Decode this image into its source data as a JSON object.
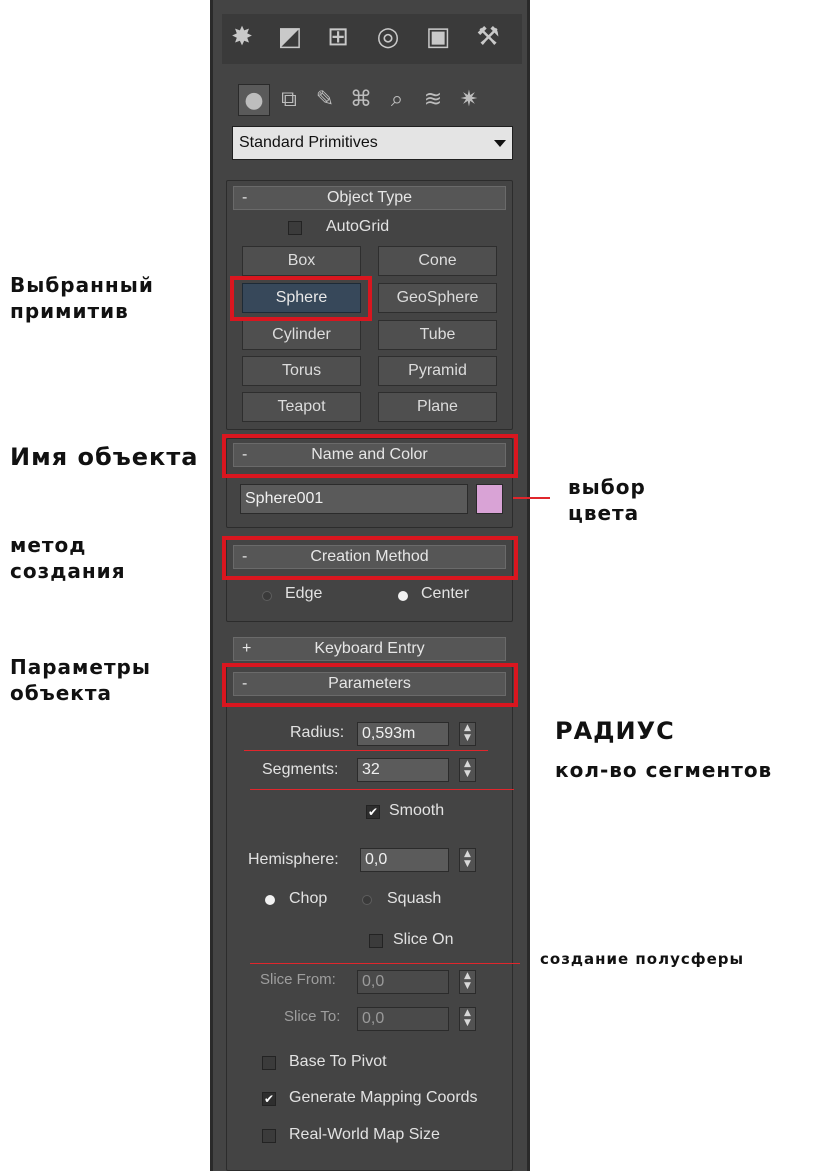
{
  "toolbar": {
    "tabs": [
      {
        "icon": "create-icon",
        "glyph": "✸"
      },
      {
        "icon": "modify-icon",
        "glyph": "◩"
      },
      {
        "icon": "hierarchy-icon",
        "glyph": "⊞"
      },
      {
        "icon": "motion-icon",
        "glyph": "◎"
      },
      {
        "icon": "display-icon",
        "glyph": "▣"
      },
      {
        "icon": "utilities-icon",
        "glyph": "⚒"
      }
    ],
    "subtabs": [
      {
        "icon": "geometry-icon",
        "glyph": "●"
      },
      {
        "icon": "shapes-icon",
        "glyph": "⧉"
      },
      {
        "icon": "lights-icon",
        "glyph": "✎"
      },
      {
        "icon": "cameras-icon",
        "glyph": "⌘"
      },
      {
        "icon": "helpers-icon",
        "glyph": "⌕"
      },
      {
        "icon": "spacewarps-icon",
        "glyph": "≋"
      },
      {
        "icon": "systems-icon",
        "glyph": "✷"
      }
    ]
  },
  "category": {
    "selected": "Standard Primitives"
  },
  "object_type": {
    "header": "Object Type",
    "collapse": "-",
    "autogrid": "AutoGrid",
    "buttons": [
      "Box",
      "Cone",
      "Sphere",
      "GeoSphere",
      "Cylinder",
      "Tube",
      "Torus",
      "Pyramid",
      "Teapot",
      "Plane"
    ],
    "selected": "Sphere"
  },
  "name_color": {
    "header": "Name and Color",
    "collapse": "-",
    "name": "Sphere001",
    "color": "#d9a3d6"
  },
  "creation_method": {
    "header": "Creation Method",
    "collapse": "-",
    "option_edge": "Edge",
    "option_center": "Center",
    "selected": "Center"
  },
  "keyboard_entry": {
    "header": "Keyboard Entry",
    "expand": "+"
  },
  "parameters": {
    "header": "Parameters",
    "collapse": "-",
    "radius_label": "Radius:",
    "radius_value": "0,593m",
    "segments_label": "Segments:",
    "segments_value": "32",
    "smooth_label": "Smooth",
    "smooth_checked": true,
    "hemisphere_label": "Hemisphere:",
    "hemisphere_value": "0,0",
    "chop_label": "Chop",
    "squash_label": "Squash",
    "hemi_mode": "Chop",
    "slice_on_label": "Slice On",
    "slice_on_checked": false,
    "slice_from_label": "Slice From:",
    "slice_from_value": "0,0",
    "slice_to_label": "Slice To:",
    "slice_to_value": "0,0",
    "base_to_pivot_label": "Base To Pivot",
    "base_to_pivot_checked": false,
    "gen_mapping_label": "Generate Mapping Coords",
    "gen_mapping_checked": true,
    "real_world_label": "Real-World Map Size",
    "real_world_checked": false
  },
  "annotations": {
    "selected_primitive": "Выбранный\nпримитив",
    "object_name": "Имя объекта",
    "color_choice": "выбор\nцвета",
    "creation_method": "метод\nсоздания",
    "object_params": "Параметры\nобъекта",
    "radius": "РАДИУС",
    "segments": "кол-во сегментов",
    "hemisphere": "создание полусферы"
  },
  "colors": {
    "highlight": "#d9161f",
    "panel": "#444444",
    "selected_button": "#37485a"
  }
}
